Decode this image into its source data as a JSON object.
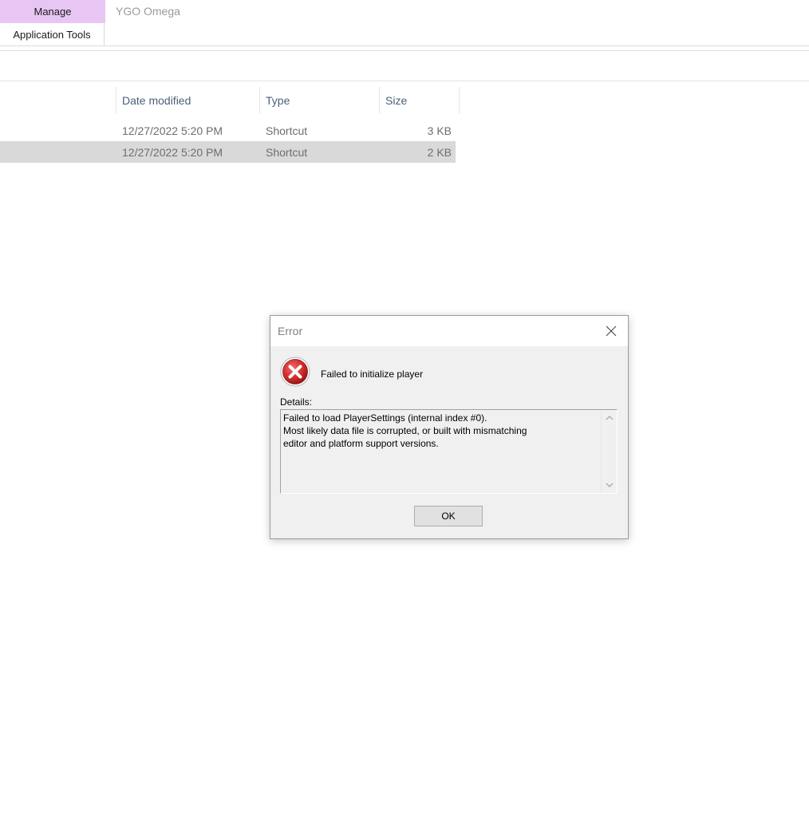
{
  "ribbon": {
    "context_tab": "Manage",
    "context_group": "Application Tools",
    "window_title": "YGO Omega",
    "context_color": "#e8c6f4"
  },
  "file_list": {
    "columns": [
      {
        "label": "Date modified"
      },
      {
        "label": "Type"
      },
      {
        "label": "Size"
      }
    ],
    "rows": [
      {
        "date": "12/27/2022 5:20 PM",
        "type": "Shortcut",
        "size": "3 KB",
        "selected": false
      },
      {
        "date": "12/27/2022 5:20 PM",
        "type": "Shortcut",
        "size": "2 KB",
        "selected": true
      }
    ]
  },
  "dialog": {
    "title": "Error",
    "icon": "error-icon",
    "message": "Failed to initialize player",
    "details_label": "Details:",
    "details_text": "Failed to load PlayerSettings (internal index #0).\nMost likely data file is corrupted, or built with mismatching\neditor and platform support versions.",
    "ok_label": "OK",
    "close_icon": "close-icon",
    "error_color": "#d32f2f"
  }
}
